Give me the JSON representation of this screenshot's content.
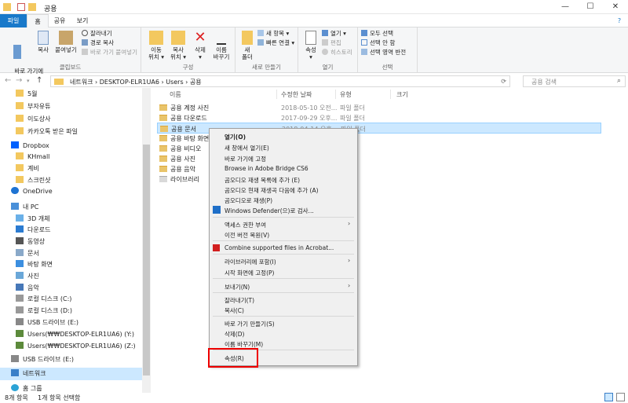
{
  "window": {
    "title": "공용",
    "minimize": "—",
    "maximize": "☐",
    "close": "✕",
    "help": "?"
  },
  "tabs": [
    {
      "label": "파일"
    },
    {
      "label": "홈"
    },
    {
      "label": "공유"
    },
    {
      "label": "보기"
    }
  ],
  "ribbon": {
    "clipboard": {
      "label": "클립보드",
      "pin": "바로 가기에\n고정",
      "copy": "복사",
      "paste": "붙여넣기",
      "cut": "잘라내기",
      "copy_path": "경로 복사",
      "paste_shortcut": "바로 가기 붙여넣기"
    },
    "organize": {
      "label": "구성",
      "move_to": "이동\n위치 ▾",
      "copy_to": "복사\n위치 ▾",
      "delete": "삭제\n▾",
      "rename": "이름\n바꾸기"
    },
    "new": {
      "label": "새로 만들기",
      "new_folder": "새\n폴더",
      "new_item": "새 항목 ▾",
      "easy_access": "빠른 연결 ▾"
    },
    "open": {
      "label": "열기",
      "properties": "속성\n▾",
      "open": "열기 ▾",
      "edit": "편집",
      "history": "히스토리"
    },
    "select": {
      "label": "선택",
      "select_all": "모두 선택",
      "select_none": "선택 안 함",
      "invert": "선택 영역 반전"
    }
  },
  "address": {
    "path": "네트워크  ›  DESKTOP-ELR1UA6  ›  Users  ›  공용",
    "search_placeholder": "공용 검색"
  },
  "nav": [
    {
      "label": "5월"
    },
    {
      "label": "부자유튜"
    },
    {
      "label": "이도상사"
    },
    {
      "label": "카카오톡 받은 파일"
    },
    {
      "label": "Dropbox"
    },
    {
      "label": "KHmall"
    },
    {
      "label": "계비"
    },
    {
      "label": "스크린샷"
    },
    {
      "label": "OneDrive"
    },
    {
      "label": "내 PC"
    },
    {
      "label": "3D 개체"
    },
    {
      "label": "다운로드"
    },
    {
      "label": "동영상"
    },
    {
      "label": "문서"
    },
    {
      "label": "바탕 화면"
    },
    {
      "label": "사진"
    },
    {
      "label": "음악"
    },
    {
      "label": "로컬 디스크 (C:)"
    },
    {
      "label": "로컬 디스크 (D:)"
    },
    {
      "label": "USB 드라이브 (E:)"
    },
    {
      "label": "Users(₩₩DESKTOP-ELR1UA6) (Y:)"
    },
    {
      "label": "Users(₩₩DESKTOP-ELR1UA6) (Z:)"
    },
    {
      "label": "USB 드라이브 (E:)"
    },
    {
      "label": "네트워크"
    },
    {
      "label": "홈 그룹"
    }
  ],
  "columns": {
    "name": "이름",
    "date": "수정한 날짜",
    "type": "유형",
    "size": "크기"
  },
  "files": [
    {
      "name": "공용 계정 사진",
      "date": "2018-05-10 오전...",
      "type": "파일 폴더"
    },
    {
      "name": "공용 다운로드",
      "date": "2017-09-29 오후...",
      "type": "파일 폴더"
    },
    {
      "name": "공용 문서",
      "date": "2018-04-14 오후...",
      "type": "파일 폴더"
    },
    {
      "name": "공용 바탕 화면",
      "date": "",
      "type": ""
    },
    {
      "name": "공용 비디오",
      "date": "",
      "type": ""
    },
    {
      "name": "공용 사진",
      "date": "",
      "type": ""
    },
    {
      "name": "공용 음악",
      "date": "",
      "type": ""
    },
    {
      "name": "라이브러리",
      "date": "",
      "type": ""
    }
  ],
  "status": {
    "count": "8개 항목",
    "selected": "1개 항목 선택함"
  },
  "context_menu": [
    {
      "label": "열기(O)"
    },
    {
      "label": "새 창에서 열기(E)"
    },
    {
      "label": "바로 가기에 고정"
    },
    {
      "label": "Browse in Adobe Bridge CS6"
    },
    {
      "label": "곰오디오 재생 목록에 추가 (E)"
    },
    {
      "label": "곰오디오 현재 재생곡 다음에 추가 (A)"
    },
    {
      "label": "곰오디오로 재생(P)"
    },
    {
      "label": "Windows Defender(으)로 검사..."
    },
    {
      "label": "액세스 권한 부여"
    },
    {
      "label": "이전 버전 복원(V)"
    },
    {
      "label": "Combine supported files in Acrobat..."
    },
    {
      "label": "라이브러리에 포함(I)"
    },
    {
      "label": "시작 화면에 고정(P)"
    },
    {
      "label": "보내기(N)"
    },
    {
      "label": "잘라내기(T)"
    },
    {
      "label": "복사(C)"
    },
    {
      "label": "바로 가기 만들기(S)"
    },
    {
      "label": "삭제(D)"
    },
    {
      "label": "이름 바꾸기(M)"
    },
    {
      "label": "속성(R)"
    }
  ]
}
